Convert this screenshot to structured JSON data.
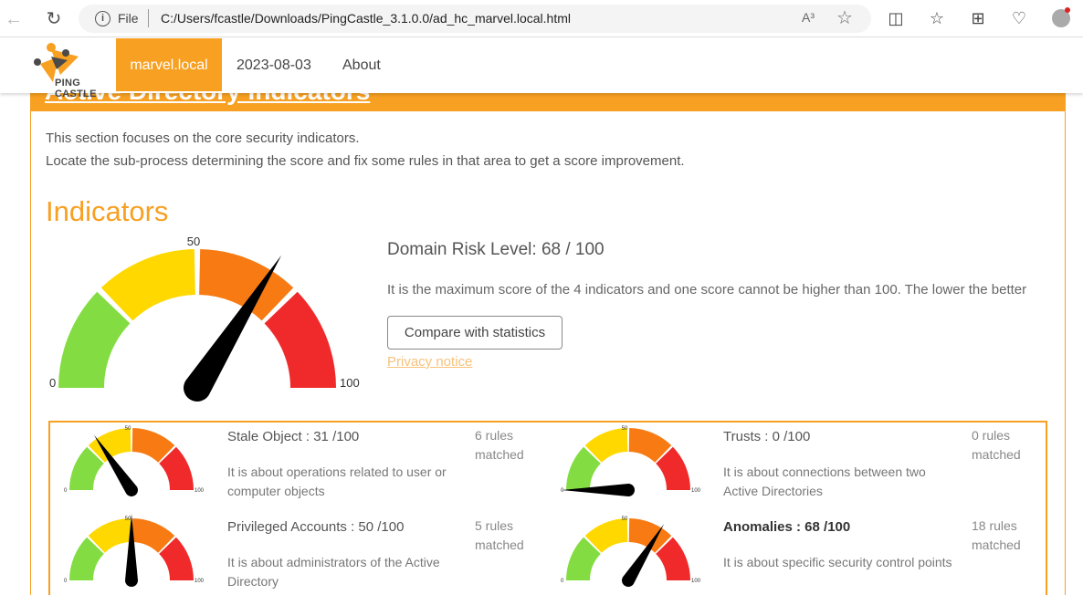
{
  "browser": {
    "file_label": "File",
    "url": "C:/Users/fcastle/Downloads/PingCastle_3.1.0.0/ad_hc_marvel.local.html",
    "read_aloud": "A³"
  },
  "header": {
    "logo_text": "PING CASTLE",
    "nav": [
      "marvel.local",
      "2023-08-03",
      "About"
    ]
  },
  "section": {
    "title": "Active Directory Indicators",
    "intro_line1": "This section focuses on the core security indicators.",
    "intro_line2": "Locate the sub-process determining the score and fix some rules in that area to get a score improvement."
  },
  "indicators": {
    "heading": "Indicators",
    "main_gauge": {
      "value": 68,
      "min_label": "0",
      "mid_label": "50",
      "max_label": "100"
    },
    "risk_title": "Domain Risk Level: 68 / 100",
    "risk_desc": "It is the maximum score of the 4 indicators and one score cannot be higher than 100. The lower the better",
    "compare_button": "Compare with statistics",
    "privacy_link": "Privacy notice"
  },
  "colors": {
    "accent": "#f7a021",
    "gauge_green": "#83dd42",
    "gauge_yellow": "#ffd800",
    "gauge_orange": "#f77a12",
    "gauge_red": "#f02a2a"
  },
  "cards": [
    {
      "title": "Stale Object : 31 /100",
      "value": 31,
      "rules_line1": "6 rules",
      "rules_line2": "matched",
      "desc_line1": "It is about operations related to user or",
      "desc_line2": "computer objects",
      "bold": false
    },
    {
      "title": "Trusts : 0 /100",
      "value": 0,
      "rules_line1": "0 rules",
      "rules_line2": "matched",
      "desc_line1": "It is about connections between two",
      "desc_line2": "Active Directories",
      "bold": false
    },
    {
      "title": "Privileged Accounts : 50 /100",
      "value": 50,
      "rules_line1": "5 rules",
      "rules_line2": "matched",
      "desc_line1": "It is about administrators of the Active",
      "desc_line2": "Directory",
      "bold": false
    },
    {
      "title": "Anomalies : 68 /100",
      "value": 68,
      "rules_line1": "18 rules",
      "rules_line2": "matched",
      "desc_line1": "It is about specific security control points",
      "desc_line2": "",
      "bold": true
    }
  ],
  "mini_gauge_labels": {
    "min": "0",
    "mid": "50",
    "max": "100"
  }
}
